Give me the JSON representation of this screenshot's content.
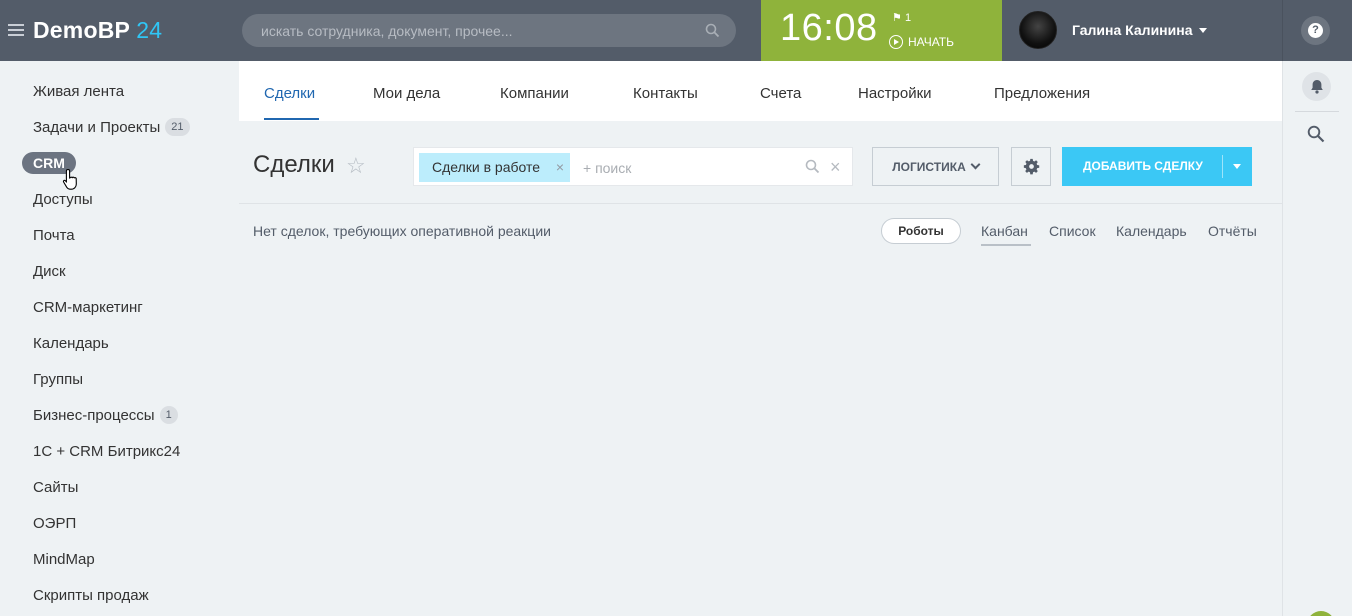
{
  "header": {
    "logo_name": "DemoBP",
    "logo_num": "24",
    "search_placeholder": "искать сотрудника, документ, прочее...",
    "time": "16:08",
    "flag_count": "1",
    "start_label": "НАЧАТЬ",
    "user_name": "Галина Калинина",
    "help_label": "?"
  },
  "sidebar": {
    "items": [
      {
        "label": "Живая лента"
      },
      {
        "label": "Задачи и Проекты",
        "badge": "21"
      },
      {
        "label": "CRM"
      },
      {
        "label": "Доступы"
      },
      {
        "label": "Почта"
      },
      {
        "label": "Диск"
      },
      {
        "label": "CRM-маркетинг"
      },
      {
        "label": "Календарь"
      },
      {
        "label": "Группы"
      },
      {
        "label": "Бизнес-процессы",
        "badge": "1"
      },
      {
        "label": "1С + CRM Битрикс24"
      },
      {
        "label": "Сайты"
      },
      {
        "label": "ОЭРП"
      },
      {
        "label": "MindMap"
      },
      {
        "label": "Скрипты продаж"
      }
    ]
  },
  "tabs": [
    "Сделки",
    "Мои дела",
    "Компании",
    "Контакты",
    "Счета",
    "Настройки",
    "Предложения"
  ],
  "page": {
    "title": "Сделки",
    "filter_chip": "Сделки в работе",
    "filter_placeholder": "+ поиск",
    "category_button": "ЛОГИСТИКА",
    "add_button": "ДОБАВИТЬ СДЕЛКУ",
    "notice": "Нет сделок, требующих оперативной реакции",
    "robots_button": "Роботы",
    "views": [
      "Канбан",
      "Список",
      "Календарь",
      "Отчёты"
    ]
  },
  "colors": {
    "header_bg": "#535c69",
    "timer_bg": "#8fb33b",
    "accent": "#3bc8f5",
    "active_tab": "#2067b0"
  }
}
